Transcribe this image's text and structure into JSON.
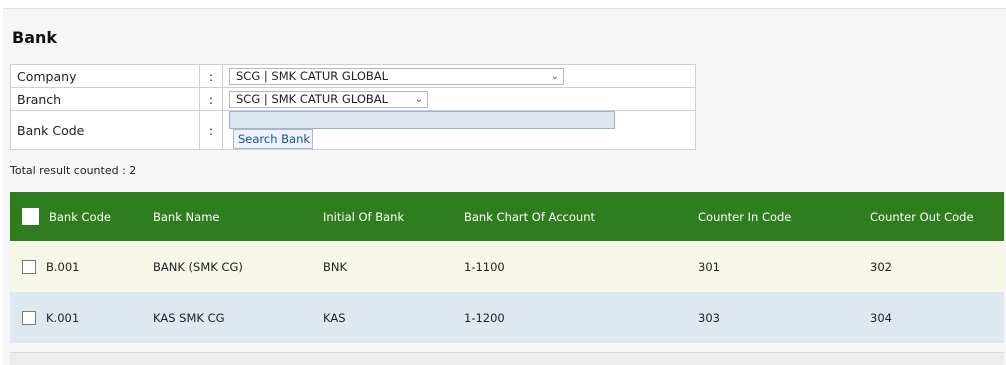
{
  "page": {
    "title": "Bank"
  },
  "filters": {
    "company": {
      "label": "Company",
      "colon": ":",
      "value": "SCG | SMK CATUR GLOBAL"
    },
    "branch": {
      "label": "Branch",
      "colon": ":",
      "value": "SCG | SMK CATUR GLOBAL"
    },
    "bank_code": {
      "label": "Bank Code",
      "colon": ":",
      "value": "",
      "button": "Search Bank"
    }
  },
  "result": {
    "total_text": "Total result counted : 2"
  },
  "grid": {
    "headers": [
      "Bank Code",
      "Bank Name",
      "Initial Of Bank",
      "Bank Chart Of Account",
      "Counter In Code",
      "Counter Out Code"
    ],
    "rows": [
      [
        "B.001",
        "BANK (SMK CG)",
        "BNK",
        "1-1100",
        "301",
        "302"
      ],
      [
        "K.001",
        "KAS SMK CG",
        "KAS",
        "1-1200",
        "303",
        "304"
      ]
    ]
  },
  "colors": {
    "header_green": "#2f7d1f",
    "row_odd": "#f7f7e8",
    "row_even": "#dfe7f1"
  }
}
